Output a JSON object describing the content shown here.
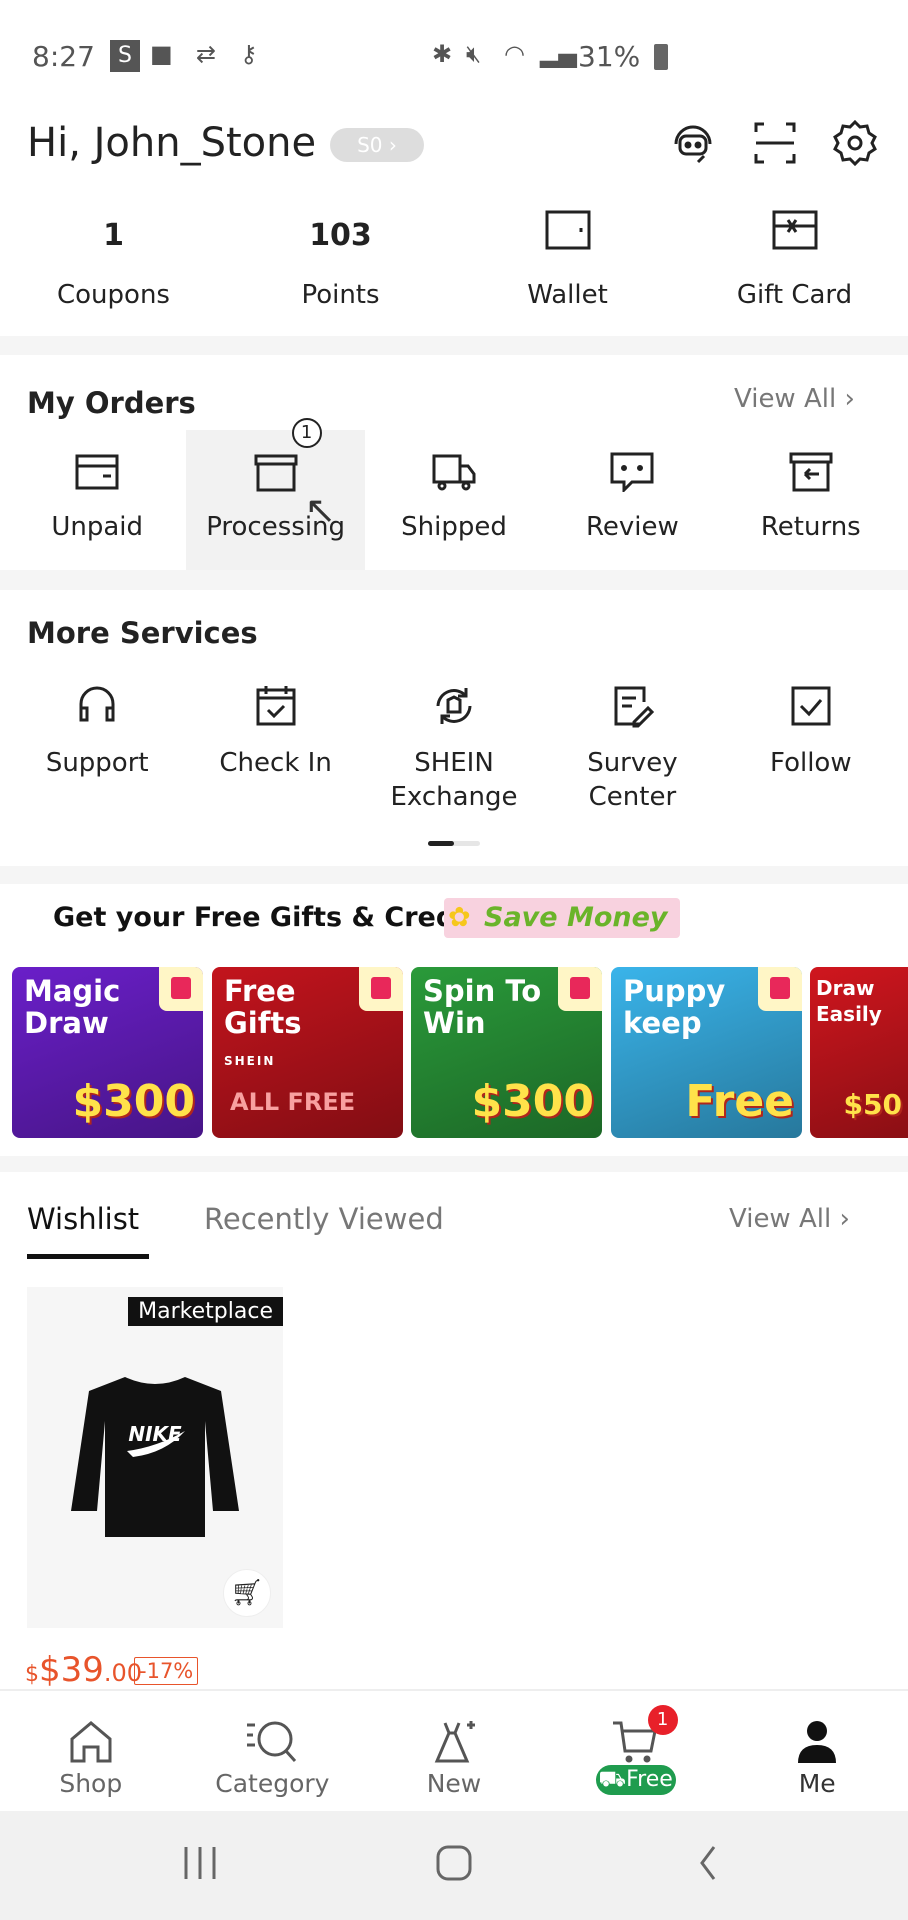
{
  "status_bar": {
    "time": "8:27",
    "badge": "S",
    "battery": "31%"
  },
  "header": {
    "greeting": "Hi, John_Stone",
    "level": "S0 ›"
  },
  "stats": [
    {
      "value": "1",
      "label": "Coupons"
    },
    {
      "value": "103",
      "label": "Points"
    },
    {
      "label": "Wallet",
      "icon": "wallet-icon"
    },
    {
      "label": "Gift Card",
      "icon": "gift-card-icon"
    }
  ],
  "orders": {
    "title": "My Orders",
    "view_all": "View All",
    "items": [
      {
        "label": "Unpaid"
      },
      {
        "label": "Processing",
        "badge": "1"
      },
      {
        "label": "Shipped"
      },
      {
        "label": "Review"
      },
      {
        "label": "Returns"
      }
    ]
  },
  "services": {
    "title": "More Services",
    "items": [
      {
        "label": "Support"
      },
      {
        "label": "Check In"
      },
      {
        "label": "SHEIN Exchange"
      },
      {
        "label": "Survey Center"
      },
      {
        "label": "Follow"
      }
    ]
  },
  "gifts": {
    "title": "Get your Free Gifts & Credit",
    "tag": "Save Money",
    "banners": [
      {
        "title": "Magic Draw",
        "amount": "$300",
        "color": "#6a1fc9"
      },
      {
        "title": "Free Gifts",
        "sub": "SHEIN",
        "amount": "ALL FREE",
        "color": "#c3141d"
      },
      {
        "title": "Spin To Win",
        "amount": "$300",
        "color": "#2a9a3a"
      },
      {
        "title": "Puppy keep",
        "amount": "Free",
        "color": "#3ab4ea"
      },
      {
        "title": "Draw Easily",
        "amount": "$50",
        "color": "#d0161e"
      }
    ]
  },
  "wishlist": {
    "tabs": [
      "Wishlist",
      "Recently Viewed"
    ],
    "active_tab": "Wishlist",
    "view_all": "View All",
    "products": [
      {
        "tag": "Marketplace",
        "brand": "NIKE",
        "price_main": "$39",
        "price_cents": ".00",
        "discount": "-17%"
      }
    ]
  },
  "bottom_nav": {
    "items": [
      {
        "label": "Shop"
      },
      {
        "label": "Category"
      },
      {
        "label": "New"
      },
      {
        "label": "Free",
        "badge": "1"
      },
      {
        "label": "Me"
      }
    ],
    "active": "Me"
  },
  "colors": {
    "price": "#e8542b",
    "free_green": "#1f9c4e",
    "badge_red": "#e8202a"
  }
}
